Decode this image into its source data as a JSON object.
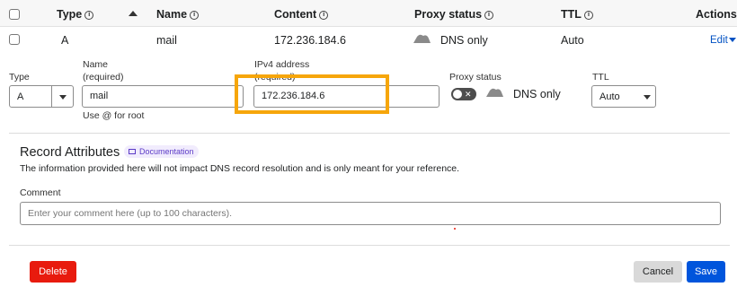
{
  "table_header": {
    "type": "Type",
    "name": "Name",
    "content": "Content",
    "proxy_status": "Proxy status",
    "ttl": "TTL",
    "actions": "Actions"
  },
  "record": {
    "type": "A",
    "name": "mail",
    "content": "172.236.184.6",
    "proxy_status": "DNS only",
    "ttl": "Auto",
    "edit_label": "Edit"
  },
  "form": {
    "type_label": "Type",
    "type_value": "A",
    "name_label": "Name",
    "name_required": "(required)",
    "name_value": "mail",
    "name_help": "Use @ for root",
    "ipv4_label": "IPv4 address",
    "ipv4_required": "(required)",
    "ipv4_value": "172.236.184.6",
    "proxy_label": "Proxy status",
    "proxy_value": "DNS only",
    "ttl_label": "TTL",
    "ttl_value": "Auto"
  },
  "attributes": {
    "title": "Record Attributes",
    "doc_badge": "Documentation",
    "description": "The information provided here will not impact DNS record resolution and is only meant for your reference.",
    "comment_label": "Comment",
    "comment_placeholder": "Enter your comment here (up to 100 characters)."
  },
  "buttons": {
    "delete": "Delete",
    "cancel": "Cancel",
    "save": "Save"
  },
  "colors": {
    "highlight": "#f6a60b",
    "delete": "#e81b0e",
    "save": "#0055dc",
    "link": "#0051c3"
  },
  "icons": [
    "info-icon",
    "sort-up-icon",
    "cloud-icon",
    "chevron-down-icon",
    "book-icon",
    "toggle-off-icon"
  ]
}
